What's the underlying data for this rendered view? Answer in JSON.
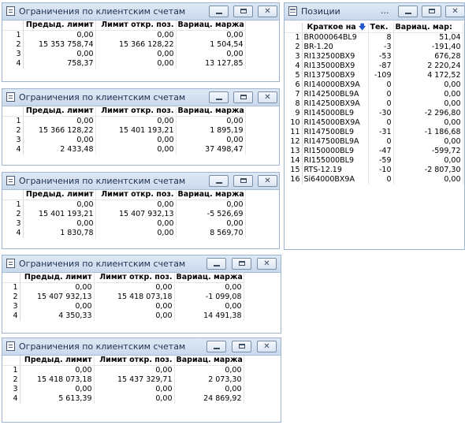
{
  "limits_windows": [
    {
      "title": "Ограничения по клиентским счетам",
      "headers": [
        "Предыд. лимит",
        "Лимит откр. поз.",
        "Вариац. маржа"
      ],
      "rows": [
        {
          "n": "1",
          "c": [
            "0,00",
            "0,00",
            "0,00"
          ]
        },
        {
          "n": "2",
          "c": [
            "15 353 758,74",
            "15 366 128,22",
            "1 504,54"
          ]
        },
        {
          "n": "3",
          "c": [
            "0,00",
            "0,00",
            "0,00"
          ]
        },
        {
          "n": "4",
          "c": [
            "758,37",
            "0,00",
            "13 127,85"
          ]
        }
      ]
    },
    {
      "title": "Ограничения по клиентским счетам",
      "headers": [
        "Предыд. лимит",
        "Лимит откр. поз.",
        "Вариац. маржа"
      ],
      "rows": [
        {
          "n": "1",
          "c": [
            "0,00",
            "0,00",
            "0,00"
          ]
        },
        {
          "n": "2",
          "c": [
            "15 366 128,22",
            "15 401 193,21",
            "1 895,19"
          ]
        },
        {
          "n": "3",
          "c": [
            "0,00",
            "0,00",
            "0,00"
          ]
        },
        {
          "n": "4",
          "c": [
            "2 433,48",
            "0,00",
            "37 498,47"
          ]
        }
      ]
    },
    {
      "title": "Ограничения по клиентским счетам",
      "headers": [
        "Предыд. лимит",
        "Лимит откр. поз.",
        "Вариац. маржа"
      ],
      "rows": [
        {
          "n": "1",
          "c": [
            "0,00",
            "0,00",
            "0,00"
          ]
        },
        {
          "n": "2",
          "c": [
            "15 401 193,21",
            "15 407 932,13",
            "-5 526,69"
          ]
        },
        {
          "n": "3",
          "c": [
            "0,00",
            "0,00",
            "0,00"
          ]
        },
        {
          "n": "4",
          "c": [
            "1 830,78",
            "0,00",
            "8 569,70"
          ]
        }
      ]
    },
    {
      "title": "Ограничения по клиентским счетам",
      "headers": [
        "Предыд. лимит",
        "Лимит откр. поз.",
        "Вариац. маржа"
      ],
      "rows": [
        {
          "n": "1",
          "c": [
            "0,00",
            "0,00",
            "0,00"
          ]
        },
        {
          "n": "2",
          "c": [
            "15 407 932,13",
            "15 418 073,18",
            "-1 099,08"
          ]
        },
        {
          "n": "3",
          "c": [
            "0,00",
            "0,00",
            "0,00"
          ]
        },
        {
          "n": "4",
          "c": [
            "4 350,33",
            "0,00",
            "14 491,38"
          ]
        }
      ]
    },
    {
      "title": "Ограничения по клиентским счетам",
      "headers": [
        "Предыд. лимит",
        "Лимит откр. поз.",
        "Вариац. маржа"
      ],
      "rows": [
        {
          "n": "1",
          "c": [
            "0,00",
            "0,00",
            "0,00"
          ]
        },
        {
          "n": "2",
          "c": [
            "15 418 073,18",
            "15 437 329,71",
            "2 073,30"
          ]
        },
        {
          "n": "3",
          "c": [
            "0,00",
            "0,00",
            "0,00"
          ]
        },
        {
          "n": "4",
          "c": [
            "5 613,39",
            "0,00",
            "24 869,92"
          ]
        }
      ]
    }
  ],
  "positions_window": {
    "title": "Позиции",
    "ellipsis": "...",
    "headers": [
      "Краткое на",
      "Тек.",
      "Вариац. мар:"
    ],
    "sort_indicator": "🡇",
    "rows": [
      {
        "n": "1",
        "c": [
          "BR000064BL9",
          "8",
          "51,04"
        ]
      },
      {
        "n": "2",
        "c": [
          "BR-1.20",
          "-3",
          "-191,40"
        ]
      },
      {
        "n": "3",
        "c": [
          "RI132500BX9",
          "-53",
          "676,28"
        ]
      },
      {
        "n": "4",
        "c": [
          "RI135000BX9",
          "-87",
          "2 220,24"
        ]
      },
      {
        "n": "5",
        "c": [
          "RI137500BX9",
          "-109",
          "4 172,52"
        ]
      },
      {
        "n": "6",
        "c": [
          "RI140000BX9A",
          "0",
          "0,00"
        ]
      },
      {
        "n": "7",
        "c": [
          "RI142500BL9A",
          "0",
          "0,00"
        ]
      },
      {
        "n": "8",
        "c": [
          "RI142500BX9A",
          "0",
          "0,00"
        ]
      },
      {
        "n": "9",
        "c": [
          "RI145000BL9",
          "-30",
          "-2 296,80"
        ]
      },
      {
        "n": "10",
        "c": [
          "RI145000BX9A",
          "0",
          "0,00"
        ]
      },
      {
        "n": "11",
        "c": [
          "RI147500BL9",
          "-31",
          "-1 186,68"
        ]
      },
      {
        "n": "12",
        "c": [
          "RI147500BL9A",
          "0",
          "0,00"
        ]
      },
      {
        "n": "13",
        "c": [
          "RI150000BL9",
          "-47",
          "-599,72"
        ]
      },
      {
        "n": "14",
        "c": [
          "RI155000BL9",
          "-59",
          "0,00"
        ]
      },
      {
        "n": "15",
        "c": [
          "RTS-12.19",
          "-10",
          "-2 807,30"
        ]
      },
      {
        "n": "16",
        "c": [
          "Si64000BX9A",
          "0",
          "0,00"
        ]
      }
    ]
  },
  "window_buttons": {
    "minimize": "minimize",
    "maximize": "maximize",
    "close": "✕"
  }
}
